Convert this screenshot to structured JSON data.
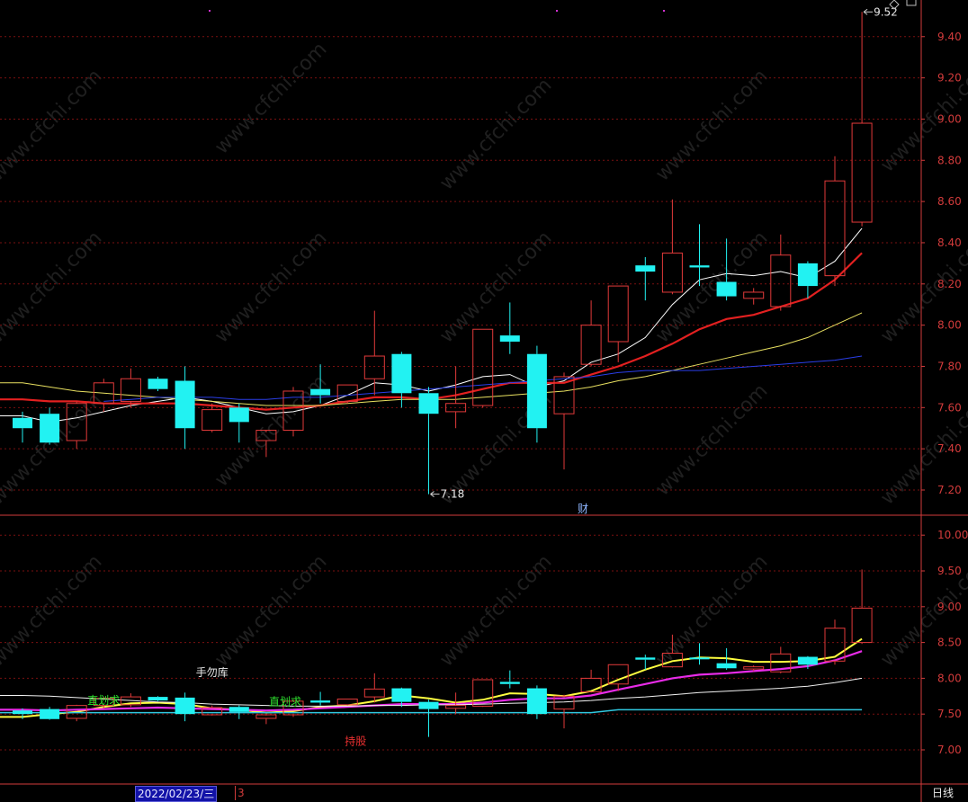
{
  "chart_data": [
    {
      "type": "candlestick",
      "panel": "main",
      "y_ticks": [
        "9.40",
        "9.20",
        "9.00",
        "8.80",
        "8.60",
        "8.40",
        "8.20",
        "8.00",
        "7.80",
        "7.60",
        "7.40",
        "7.20"
      ],
      "ylim": [
        7.08,
        9.56
      ],
      "grid": true,
      "candles": [
        {
          "o": 7.55,
          "h": 7.58,
          "l": 7.43,
          "c": 7.5
        },
        {
          "o": 7.57,
          "h": 7.6,
          "l": 7.42,
          "c": 7.43
        },
        {
          "o": 7.44,
          "h": 7.63,
          "l": 7.4,
          "c": 7.62
        },
        {
          "o": 7.62,
          "h": 7.74,
          "l": 7.58,
          "c": 7.72
        },
        {
          "o": 7.63,
          "h": 7.79,
          "l": 7.6,
          "c": 7.74
        },
        {
          "o": 7.74,
          "h": 7.75,
          "l": 7.68,
          "c": 7.69
        },
        {
          "o": 7.73,
          "h": 7.8,
          "l": 7.4,
          "c": 7.5
        },
        {
          "o": 7.49,
          "h": 7.62,
          "l": 7.48,
          "c": 7.59
        },
        {
          "o": 7.6,
          "h": 7.62,
          "l": 7.43,
          "c": 7.53
        },
        {
          "o": 7.44,
          "h": 7.48,
          "l": 7.36,
          "c": 7.49
        },
        {
          "o": 7.49,
          "h": 7.7,
          "l": 7.46,
          "c": 7.68
        },
        {
          "o": 7.69,
          "h": 7.81,
          "l": 7.62,
          "c": 7.66
        },
        {
          "o": 7.63,
          "h": 7.71,
          "l": 7.62,
          "c": 7.71
        },
        {
          "o": 7.74,
          "h": 8.07,
          "l": 7.66,
          "c": 7.85
        },
        {
          "o": 7.86,
          "h": 7.87,
          "l": 7.6,
          "c": 7.67
        },
        {
          "o": 7.67,
          "h": 7.7,
          "l": 7.18,
          "c": 7.57
        },
        {
          "o": 7.58,
          "h": 7.8,
          "l": 7.5,
          "c": 7.62
        },
        {
          "o": 7.61,
          "h": 7.98,
          "l": 7.6,
          "c": 7.98
        },
        {
          "o": 7.95,
          "h": 8.11,
          "l": 7.86,
          "c": 7.92
        },
        {
          "o": 7.86,
          "h": 7.9,
          "l": 7.43,
          "c": 7.5
        },
        {
          "o": 7.57,
          "h": 7.77,
          "l": 7.3,
          "c": 7.75
        },
        {
          "o": 7.81,
          "h": 8.12,
          "l": 7.8,
          "c": 8.0
        },
        {
          "o": 7.92,
          "h": 8.19,
          "l": 7.82,
          "c": 8.19
        },
        {
          "o": 8.29,
          "h": 8.33,
          "l": 8.12,
          "c": 8.26
        },
        {
          "o": 8.16,
          "h": 8.61,
          "l": 8.15,
          "c": 8.35
        },
        {
          "o": 8.29,
          "h": 8.49,
          "l": 8.19,
          "c": 8.28
        },
        {
          "o": 8.21,
          "h": 8.42,
          "l": 8.12,
          "c": 8.14
        },
        {
          "o": 8.13,
          "h": 8.18,
          "l": 8.1,
          "c": 8.16
        },
        {
          "o": 8.09,
          "h": 8.44,
          "l": 8.07,
          "c": 8.34
        },
        {
          "o": 8.3,
          "h": 8.31,
          "l": 8.13,
          "c": 8.19
        },
        {
          "o": 8.24,
          "h": 8.82,
          "l": 8.19,
          "c": 8.7
        },
        {
          "o": 8.5,
          "h": 9.52,
          "l": 8.48,
          "c": 8.98
        }
      ],
      "ma_lines": [
        {
          "color": "#ffffff",
          "values": [
            7.56,
            7.53,
            7.55,
            7.58,
            7.61,
            7.63,
            7.65,
            7.63,
            7.6,
            7.57,
            7.58,
            7.61,
            7.66,
            7.72,
            7.71,
            7.68,
            7.71,
            7.75,
            7.76,
            7.7,
            7.73,
            7.82,
            7.86,
            7.94,
            8.1,
            8.22,
            8.25,
            8.24,
            8.26,
            8.23,
            8.31,
            8.47
          ]
        },
        {
          "color": "#e32020",
          "values": [
            7.64,
            7.63,
            7.63,
            7.62,
            7.62,
            7.62,
            7.62,
            7.61,
            7.6,
            7.59,
            7.6,
            7.61,
            7.63,
            7.65,
            7.65,
            7.64,
            7.66,
            7.69,
            7.72,
            7.72,
            7.72,
            7.76,
            7.8,
            7.85,
            7.91,
            7.98,
            8.03,
            8.05,
            8.09,
            8.13,
            8.22,
            8.35
          ]
        },
        {
          "color": "#e8e060",
          "values": [
            7.72,
            7.7,
            7.68,
            7.67,
            7.66,
            7.65,
            7.64,
            7.63,
            7.62,
            7.61,
            7.61,
            7.61,
            7.62,
            7.63,
            7.64,
            7.64,
            7.64,
            7.65,
            7.66,
            7.67,
            7.68,
            7.7,
            7.73,
            7.75,
            7.78,
            7.81,
            7.84,
            7.87,
            7.9,
            7.94,
            8.0,
            8.06
          ]
        },
        {
          "color": "#2a3ee8",
          "values": [
            null,
            null,
            null,
            7.63,
            7.64,
            7.65,
            7.65,
            7.65,
            7.64,
            7.64,
            7.65,
            7.65,
            7.66,
            7.67,
            7.68,
            7.69,
            7.7,
            7.71,
            7.72,
            7.73,
            7.74,
            7.75,
            7.77,
            7.78,
            7.78,
            7.78,
            7.79,
            7.8,
            7.81,
            7.82,
            7.83,
            7.85
          ]
        }
      ],
      "annotations": [
        {
          "text": "9.52",
          "x_index": 31,
          "y": 9.52,
          "side": "right"
        },
        {
          "text": "7.18",
          "x_index": 15,
          "y": 7.18,
          "side": "right"
        }
      ]
    },
    {
      "type": "candlestick",
      "panel": "lower",
      "y_ticks": [
        "10.00",
        "9.50",
        "9.00",
        "8.50",
        "8.00",
        "7.50",
        "7.00"
      ],
      "ylim": [
        6.6,
        10.25
      ],
      "grid": true,
      "lines": [
        {
          "color": "#ffff40",
          "values": [
            7.46,
            7.5,
            7.53,
            7.6,
            7.65,
            7.66,
            7.64,
            7.58,
            7.56,
            7.52,
            7.54,
            7.6,
            7.62,
            7.68,
            7.76,
            7.72,
            7.66,
            7.7,
            7.79,
            7.78,
            7.75,
            7.82,
            7.98,
            8.12,
            8.24,
            8.29,
            8.28,
            8.23,
            8.23,
            8.24,
            8.3,
            8.55
          ]
        },
        {
          "color": "#e82be8",
          "values": [
            7.56,
            7.55,
            7.56,
            7.57,
            7.58,
            7.59,
            7.58,
            7.57,
            7.56,
            7.55,
            7.56,
            7.58,
            7.6,
            7.62,
            7.64,
            7.64,
            7.64,
            7.66,
            7.7,
            7.72,
            7.72,
            7.76,
            7.84,
            7.92,
            8.0,
            8.05,
            8.07,
            8.1,
            8.13,
            8.17,
            8.25,
            8.38
          ]
        },
        {
          "color": "#f2f2f2",
          "values": [
            7.76,
            7.75,
            7.73,
            7.71,
            7.69,
            7.67,
            7.66,
            7.64,
            7.63,
            7.62,
            7.61,
            7.61,
            7.61,
            7.62,
            7.62,
            7.63,
            7.63,
            7.64,
            7.65,
            7.66,
            7.67,
            7.69,
            7.72,
            7.74,
            7.77,
            7.8,
            7.82,
            7.84,
            7.86,
            7.89,
            7.94,
            8.0
          ]
        },
        {
          "color": "#30c8e0",
          "values": [
            7.52,
            7.52,
            7.52,
            7.52,
            7.52,
            7.52,
            7.52,
            7.52,
            7.52,
            7.52,
            7.52,
            7.52,
            7.52,
            7.52,
            7.52,
            7.52,
            7.52,
            7.52,
            7.52,
            7.52,
            7.52,
            7.52,
            7.56,
            7.56,
            7.56,
            7.56,
            7.56,
            7.56,
            7.56,
            7.56,
            7.56,
            7.56
          ]
        }
      ],
      "labels": [
        {
          "text": "直划求",
          "color": "#2ee02e",
          "x_index": 3,
          "y": 7.69
        },
        {
          "text": "直划求",
          "color": "#2ee02e",
          "x_index": 9.7,
          "y": 7.67
        },
        {
          "text": "手勿库",
          "color": "#e8e8e8",
          "x_index": 7,
          "y": 8.08
        },
        {
          "text": "持股",
          "color": "#e83030",
          "x_index": 12.3,
          "y": 7.12
        }
      ]
    }
  ],
  "markers": {
    "cai": "财"
  },
  "footer": {
    "date": "2022/02/23/三",
    "marker": "3",
    "period": "日线"
  },
  "watermark": "www.cfchi.com",
  "colors": {
    "up": "#e23a3a",
    "down": "#22f2f2",
    "grid": "#7a1010",
    "axis": "#d23b3b",
    "background": "#000000"
  }
}
